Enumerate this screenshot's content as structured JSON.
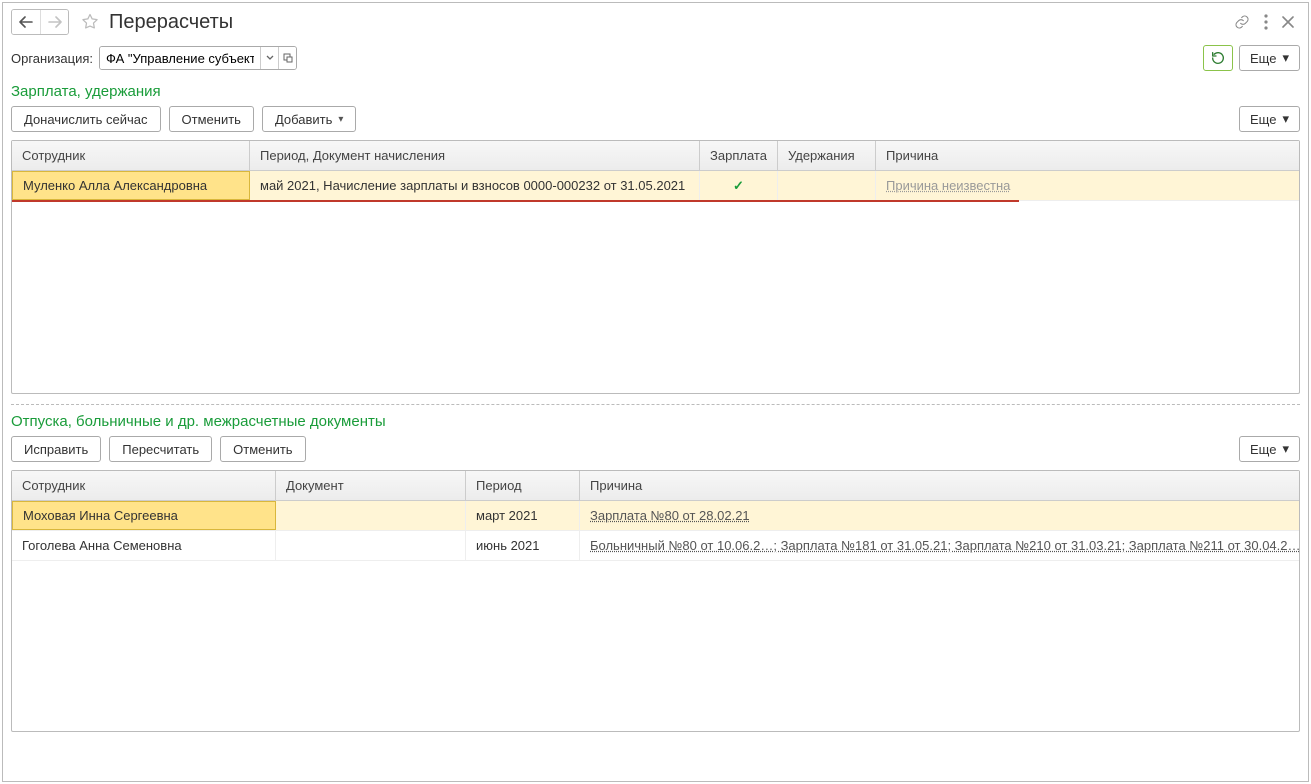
{
  "header": {
    "title": "Перерасчеты"
  },
  "filter": {
    "org_label": "Организация:",
    "org_value": "ФА \"Управление субъекта",
    "more_label": "Еще"
  },
  "section1": {
    "title": "Зарплата, удержания",
    "buttons": {
      "accrue": "Доначислить сейчас",
      "cancel": "Отменить",
      "add": "Добавить",
      "more": "Еще"
    },
    "columns": {
      "employee": "Сотрудник",
      "period_doc": "Период, Документ начисления",
      "salary": "Зарплата",
      "deductions": "Удержания",
      "reason": "Причина"
    },
    "rows": [
      {
        "employee": "Муленко Алла Александровна",
        "period_doc": "май 2021, Начисление зарплаты и взносов 0000-000232 от 31.05.2021",
        "salary_check": "✓",
        "deductions": "",
        "reason": "Причина неизвестна"
      }
    ]
  },
  "section2": {
    "title": "Отпуска, больничные и др. межрасчетные документы",
    "buttons": {
      "fix": "Исправить",
      "recalc": "Пересчитать",
      "cancel": "Отменить",
      "more": "Еще"
    },
    "columns": {
      "employee": "Сотрудник",
      "document": "Документ",
      "period": "Период",
      "reason": "Причина"
    },
    "rows": [
      {
        "employee": "Моховая Инна Сергеевна",
        "document": "",
        "period": "март 2021",
        "reason": "Зарплата №80 от 28.02.21"
      },
      {
        "employee": "Гоголева Анна Семеновна",
        "document": "",
        "period": "июнь 2021",
        "reason": "Больничный №80 от 10.06.2…; Зарплата №181 от 31.05.21; Зарплата №210 от 31.03.21; Зарплата №211 от 30.04.2…"
      }
    ]
  }
}
